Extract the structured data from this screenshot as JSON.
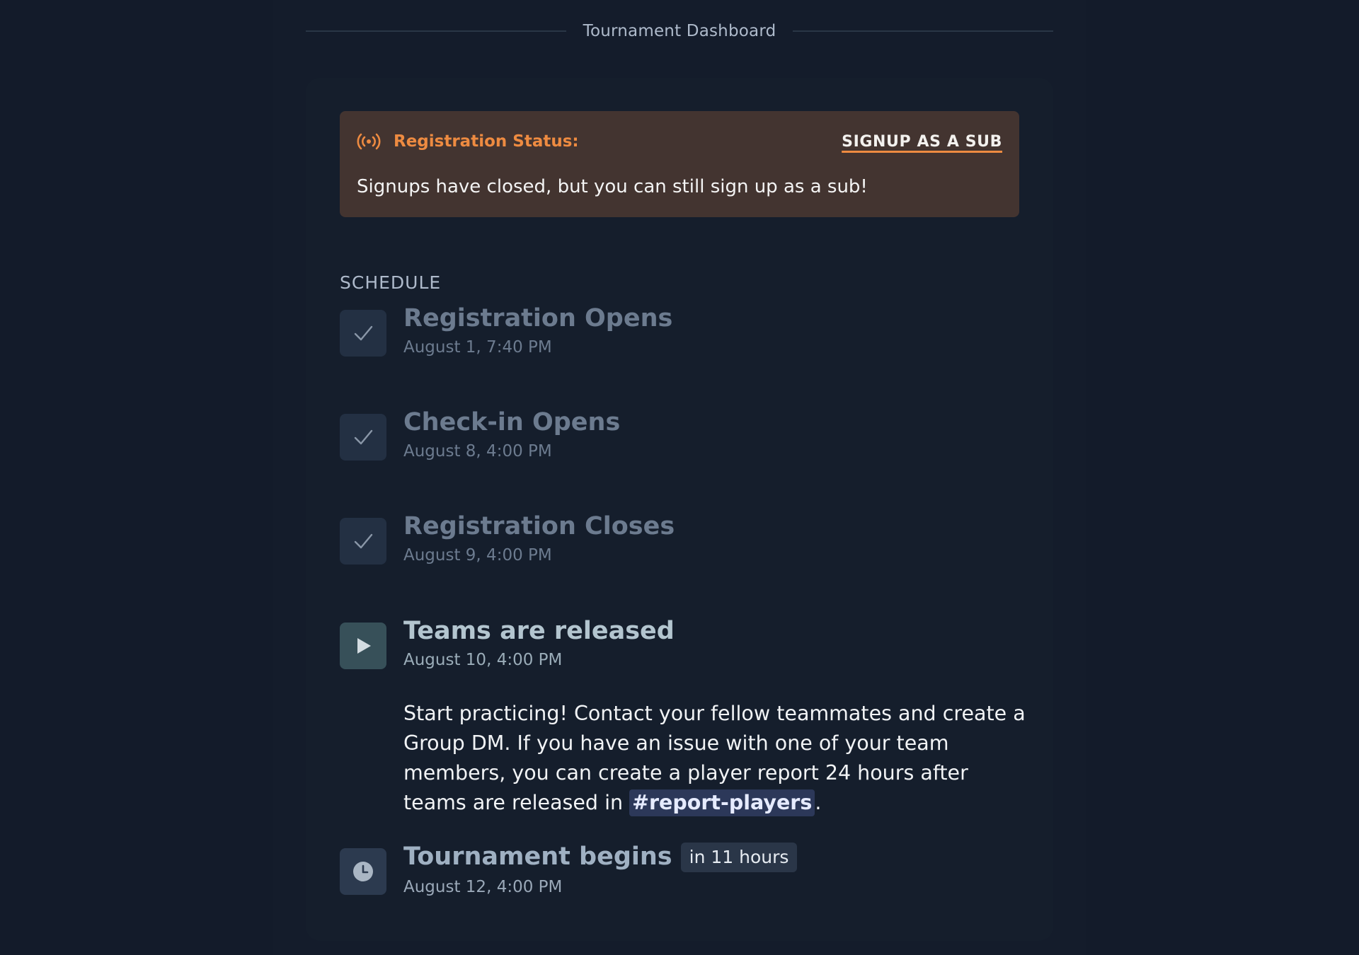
{
  "page": {
    "title": "Tournament Dashboard"
  },
  "registration_status": {
    "label": "Registration Status:",
    "action_label": "SIGNUP AS A SUB",
    "message": "Signups have closed, but you can still sign up as a sub!",
    "icon": "broadcast-icon",
    "accent_color": "#ee8b41"
  },
  "schedule": {
    "heading": "SCHEDULE",
    "steps": [
      {
        "title": "Registration Opens",
        "date": "August 1, 7:40 PM",
        "state": "done",
        "icon": "check-icon"
      },
      {
        "title": "Check-in Opens",
        "date": "August 8, 4:00 PM",
        "state": "done",
        "icon": "check-icon"
      },
      {
        "title": "Registration Closes",
        "date": "August 9, 4:00 PM",
        "state": "done",
        "icon": "check-icon"
      },
      {
        "title": "Teams are released",
        "date": "August 10, 4:00 PM",
        "state": "active",
        "icon": "play-icon",
        "description": {
          "text": "Start practicing! Contact your fellow teammates and create a Group DM. If you have an issue with one of your team members, you can create a player report 24 hours after teams are released in ",
          "channel": "#report-players",
          "suffix": "."
        }
      },
      {
        "title": "Tournament begins",
        "date": "August 12, 4:00 PM",
        "state": "upcoming",
        "icon": "clock-icon",
        "badge": "in 11 hours"
      }
    ]
  }
}
